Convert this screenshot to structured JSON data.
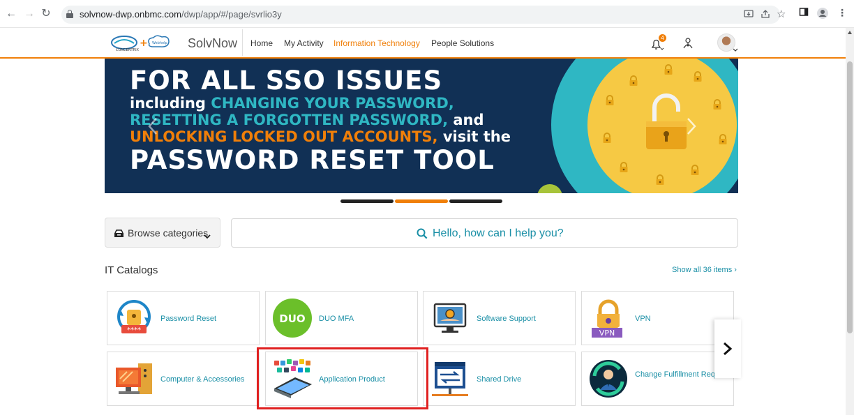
{
  "browser": {
    "url_host": "solvnow-dwp.onbmc.com",
    "url_path": "/dwp/app/#/page/svrlio3y"
  },
  "header": {
    "brand": "SolvNow",
    "nav": [
      "Home",
      "My Activity",
      "Information Technology",
      "People Solutions"
    ],
    "active_nav": "Information Technology",
    "notification_count": "4"
  },
  "banner": {
    "line1": "FOR ALL SSO ISSUES",
    "line2_a": "including ",
    "line2_b": "CHANGING YOUR PASSWORD,",
    "line3_a": "RESETTING A FORGOTTEN PASSWORD,",
    "line3_b": " and",
    "line4_a": "UNLOCKING LOCKED OUT ACCOUNTS,",
    "line4_b": " visit the",
    "line5": "PASSWORD RESET TOOL"
  },
  "carousel": {
    "slide_count": 3,
    "active_index": 1
  },
  "browse": {
    "label": "Browse categories"
  },
  "search": {
    "placeholder": "Hello, how can I help you?"
  },
  "catalog": {
    "title": "IT Catalogs",
    "show_all": "Show all 36 items ›",
    "items": [
      {
        "label": "Password Reset",
        "icon": "password-reset-icon"
      },
      {
        "label": "DUO MFA",
        "icon": "duo-mfa-icon"
      },
      {
        "label": "Software Support",
        "icon": "software-support-icon"
      },
      {
        "label": "VPN",
        "icon": "vpn-icon"
      },
      {
        "label": "Computer & Accessories",
        "icon": "computer-accessories-icon"
      },
      {
        "label": "Application Product",
        "icon": "application-product-icon"
      },
      {
        "label": "Shared Drive",
        "icon": "shared-drive-icon"
      },
      {
        "label": "Change Fulfillment Request",
        "icon": "change-fulfillment-icon"
      }
    ],
    "highlighted_item": "Application Product"
  },
  "colors": {
    "accent": "#f07f09",
    "teal": "#1a8fa6",
    "banner_bg": "#113055",
    "highlight": "#e02020"
  }
}
